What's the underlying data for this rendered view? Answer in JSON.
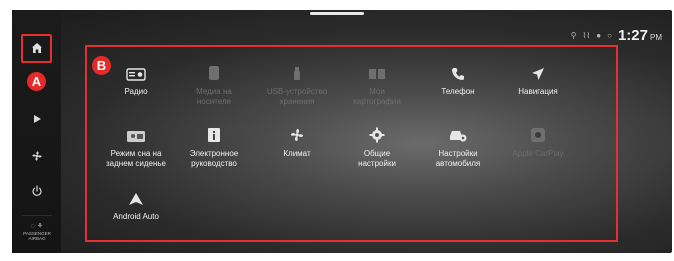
{
  "status": {
    "time": "1:27",
    "ampm": "PM",
    "icons": [
      "location-icon",
      "signal-icon",
      "user-icon",
      "cloud-icon"
    ]
  },
  "markers": {
    "a": "A",
    "b": "B"
  },
  "sidebar": {
    "items": [
      {
        "name": "home-icon"
      },
      {
        "name": "play-icon"
      },
      {
        "name": "fan-icon"
      },
      {
        "name": "power-icon"
      }
    ],
    "airbag_line1": "PASSENGER",
    "airbag_line2": "AIRBAG"
  },
  "apps": [
    {
      "icon": "radio-icon",
      "label": "Радио",
      "enabled": true
    },
    {
      "icon": "media-icon",
      "label": "Медиа на\nносителе",
      "enabled": false
    },
    {
      "icon": "usb-icon",
      "label": "USB-устройство\nхранения",
      "enabled": false
    },
    {
      "icon": "map-files-icon",
      "label": "Мои\nкартографии",
      "enabled": false
    },
    {
      "icon": "phone-icon",
      "label": "Телефон",
      "enabled": true
    },
    {
      "icon": "navigation-icon",
      "label": "Навигация",
      "enabled": true
    },
    {
      "icon": "rear-seat-icon",
      "label": "Режим сна на\nзаднем сиденье",
      "enabled": true
    },
    {
      "icon": "manual-icon",
      "label": "Электронное\nруководство",
      "enabled": true
    },
    {
      "icon": "climate-icon",
      "label": "Климат",
      "enabled": true
    },
    {
      "icon": "settings-icon",
      "label": "Общие\nнастройки",
      "enabled": true
    },
    {
      "icon": "vehicle-settings-icon",
      "label": "Настройки\nавтомобиля",
      "enabled": true
    },
    {
      "icon": "carplay-icon",
      "label": "Apple CarPlay",
      "enabled": false
    },
    {
      "icon": "android-auto-icon",
      "label": "Android Auto",
      "enabled": true
    }
  ]
}
